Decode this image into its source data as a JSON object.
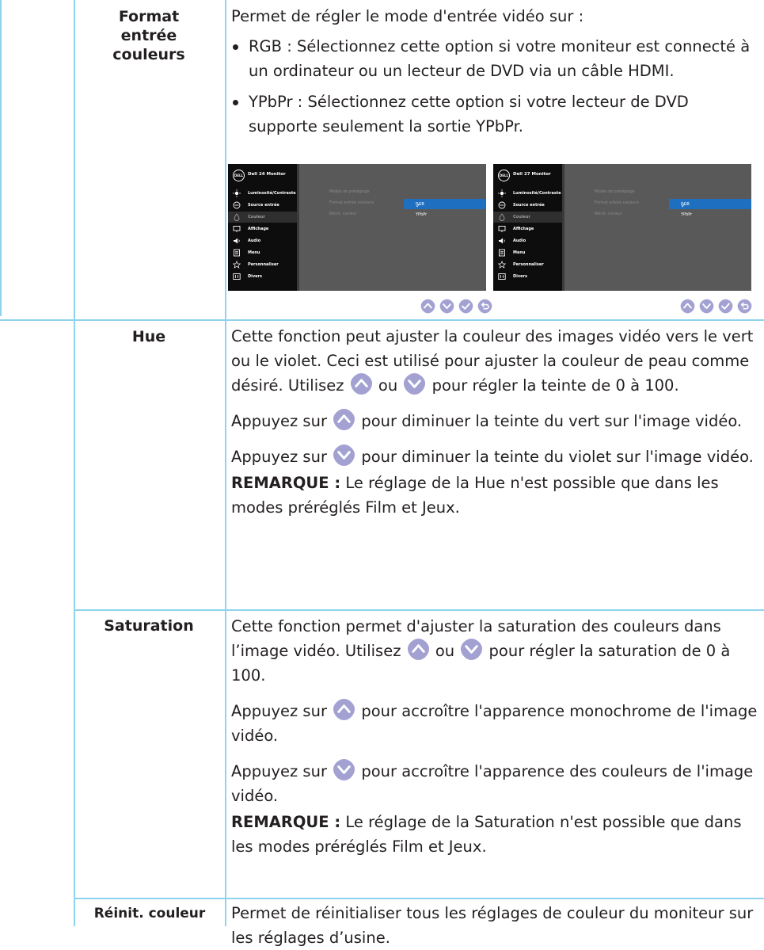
{
  "colors": {
    "rule": "#8fd3ef",
    "icon": "#a3a1d2",
    "osd_highlight": "#1f6fc0"
  },
  "rows": {
    "format": {
      "label": "Format entrée couleurs",
      "intro": "Permet de régler le mode d'entrée vidéo sur :",
      "bullets": [
        "RGB : Sélectionnez cette option si votre moniteur est connecté à un ordinateur ou un lecteur de DVD via un câble HDMI.",
        "YPbPr : Sélectionnez cette option si votre lecteur de DVD supporte seulement la sortie YPbPr."
      ]
    },
    "hue": {
      "label": "Hue",
      "p1_before": "Cette fonction peut ajuster la couleur des images vidéo vers le vert ou le violet. Ceci est utilisé pour ajuster la couleur de peau comme désiré. Utilisez",
      "p1_mid": "ou",
      "p1_after": "pour régler la teinte de 0 à 100.",
      "p2_before": "Appuyez sur",
      "p2_after": "pour diminuer la teinte du vert sur l'image vidéo.",
      "p3_before": "Appuyez sur",
      "p3_after": "pour diminuer la teinte du violet sur l'image vidéo.",
      "note_label": "REMARQUE :",
      "note_text": "Le réglage de la Hue n'est possible que dans les modes préréglés Film et Jeux."
    },
    "saturation": {
      "label": "Saturation",
      "p1_before": "Cette fonction permet d'ajuster la saturation des couleurs dans l’image vidéo. Utilisez",
      "p1_mid": "ou",
      "p1_after": "pour régler la saturation de 0 à 100.",
      "p2_before": "Appuyez sur",
      "p2_after": "pour accroître l'apparence monochrome de l'image vidéo.",
      "p3_before": "Appuyez sur",
      "p3_after": "pour accroître l'apparence des couleurs de l'image vidéo.",
      "note_label": "REMARQUE :",
      "note_text": "Le réglage de la Saturation n'est possible que dans les modes préréglés Film et Jeux."
    },
    "reset": {
      "label": "Réinit. couleur",
      "text": "Permet de réinitialiser tous les réglages de couleur du moniteur sur les réglages d’usine."
    }
  },
  "osd": {
    "models": [
      "Dell 24 Monitor",
      "Dell 27 Monitor"
    ],
    "logo": "DELL",
    "menu": [
      "Luminosité/Contraste",
      "Source entrée",
      "Couleur",
      "Affichage",
      "Audio",
      "Menu",
      "Personnaliser",
      "Divers"
    ],
    "menu_icons": [
      "brightness-icon",
      "input-source-icon",
      "color-icon",
      "display-icon",
      "audio-icon",
      "menu-icon",
      "star-icon",
      "others-icon"
    ],
    "selected_menu_item": "Couleur",
    "submenu": [
      "Modes de préréglage",
      "Format entrée couleurs",
      "Réinit. couleur"
    ],
    "options": [
      "RGB",
      "YPbPr"
    ],
    "selected_option": "RGB",
    "check": "✓"
  },
  "nav_buttons": [
    "up-icon",
    "down-icon",
    "check-icon",
    "back-icon"
  ]
}
